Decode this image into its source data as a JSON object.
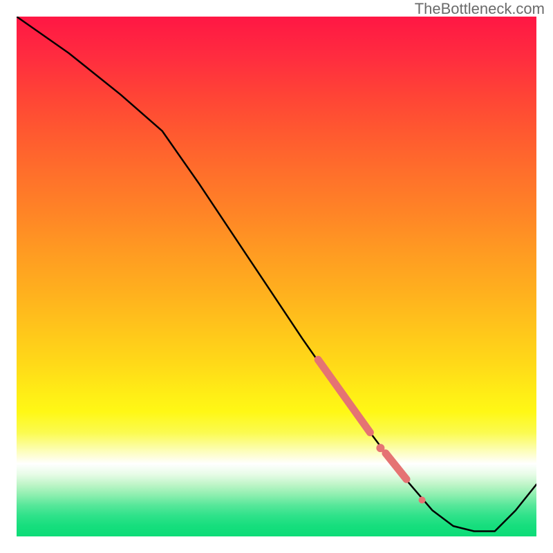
{
  "watermark": "TheBottleneck.com",
  "chart_data": {
    "type": "line",
    "title": "",
    "xlabel": "",
    "ylabel": "",
    "xlim": [
      0,
      100
    ],
    "ylim": [
      0,
      100
    ],
    "grid": false,
    "background": "rainbow-vertical-gradient",
    "series": [
      {
        "name": "main-curve",
        "color": "#000000",
        "x": [
          0,
          10,
          20,
          28,
          35,
          45,
          55,
          62,
          68,
          74,
          80,
          84,
          88,
          92,
          96,
          100
        ],
        "y": [
          100,
          93,
          85,
          78,
          68,
          53,
          38,
          28,
          20,
          12,
          5,
          2,
          1,
          1,
          5,
          10
        ]
      }
    ],
    "markers": [
      {
        "name": "segment-marker-1",
        "type": "thick-line-segment",
        "color": "#e57373",
        "x": [
          58,
          68
        ],
        "y": [
          34,
          20
        ]
      },
      {
        "name": "segment-marker-2",
        "type": "dot",
        "color": "#e57373",
        "x": 70,
        "y": 17
      },
      {
        "name": "segment-marker-3",
        "type": "thick-line-segment",
        "color": "#e57373",
        "x": [
          71,
          75
        ],
        "y": [
          16,
          11
        ]
      },
      {
        "name": "segment-marker-4",
        "type": "dot",
        "color": "#e57373",
        "x": 78,
        "y": 7
      }
    ]
  }
}
